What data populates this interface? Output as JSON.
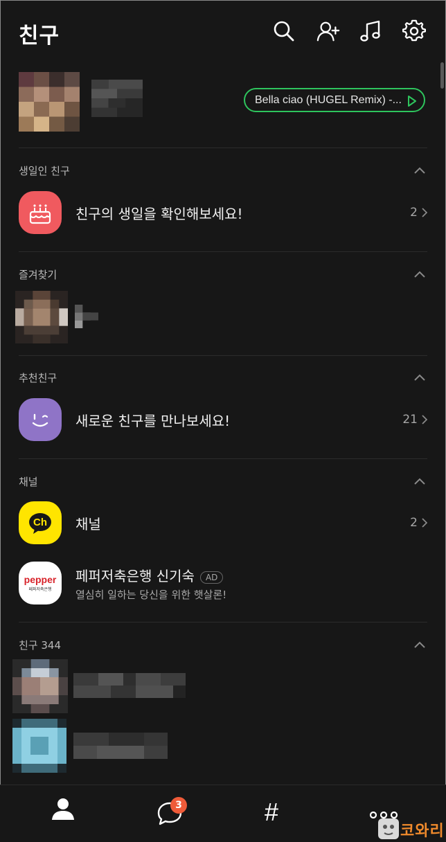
{
  "header": {
    "title": "친구",
    "icons": [
      "search-icon",
      "add-friend-icon",
      "music-icon",
      "settings-icon"
    ]
  },
  "profile": {
    "music_text": "Bella ciao (HUGEL Remix) -...",
    "music_color": "#2ec55d"
  },
  "sections": {
    "birthday": {
      "title": "생일인 친구",
      "label": "친구의 생일을 확인해보세요!",
      "count": "2"
    },
    "favorites": {
      "title": "즐겨찾기"
    },
    "recommended": {
      "title": "추천친구",
      "label": "새로운 친구를 만나보세요!",
      "count": "21"
    },
    "channel": {
      "title": "채널",
      "label": "채널",
      "count": "2",
      "channel_icon_text": "Ch",
      "ad": {
        "name": "페퍼저축은행 신기숙",
        "badge": "AD",
        "sub": "열심히 일하는 당신을 위한 햇살론!",
        "logo_text": "pepper",
        "logo_sub": "페퍼저축은행"
      }
    },
    "friends": {
      "title": "친구 344"
    }
  },
  "bottom_nav": {
    "items": [
      "friends-tab",
      "chats-tab",
      "openchat-tab",
      "more-tab"
    ],
    "chat_badge": "3",
    "hash_label": "#"
  },
  "watermark": {
    "text": "코와리"
  },
  "colors": {
    "background": "#171717",
    "birthday_icon": "#f05a5f",
    "recommend_icon": "#8f74c7",
    "channel_icon": "#ffe500",
    "badge": "#ef5b39",
    "watermark": "#f08a2c"
  }
}
